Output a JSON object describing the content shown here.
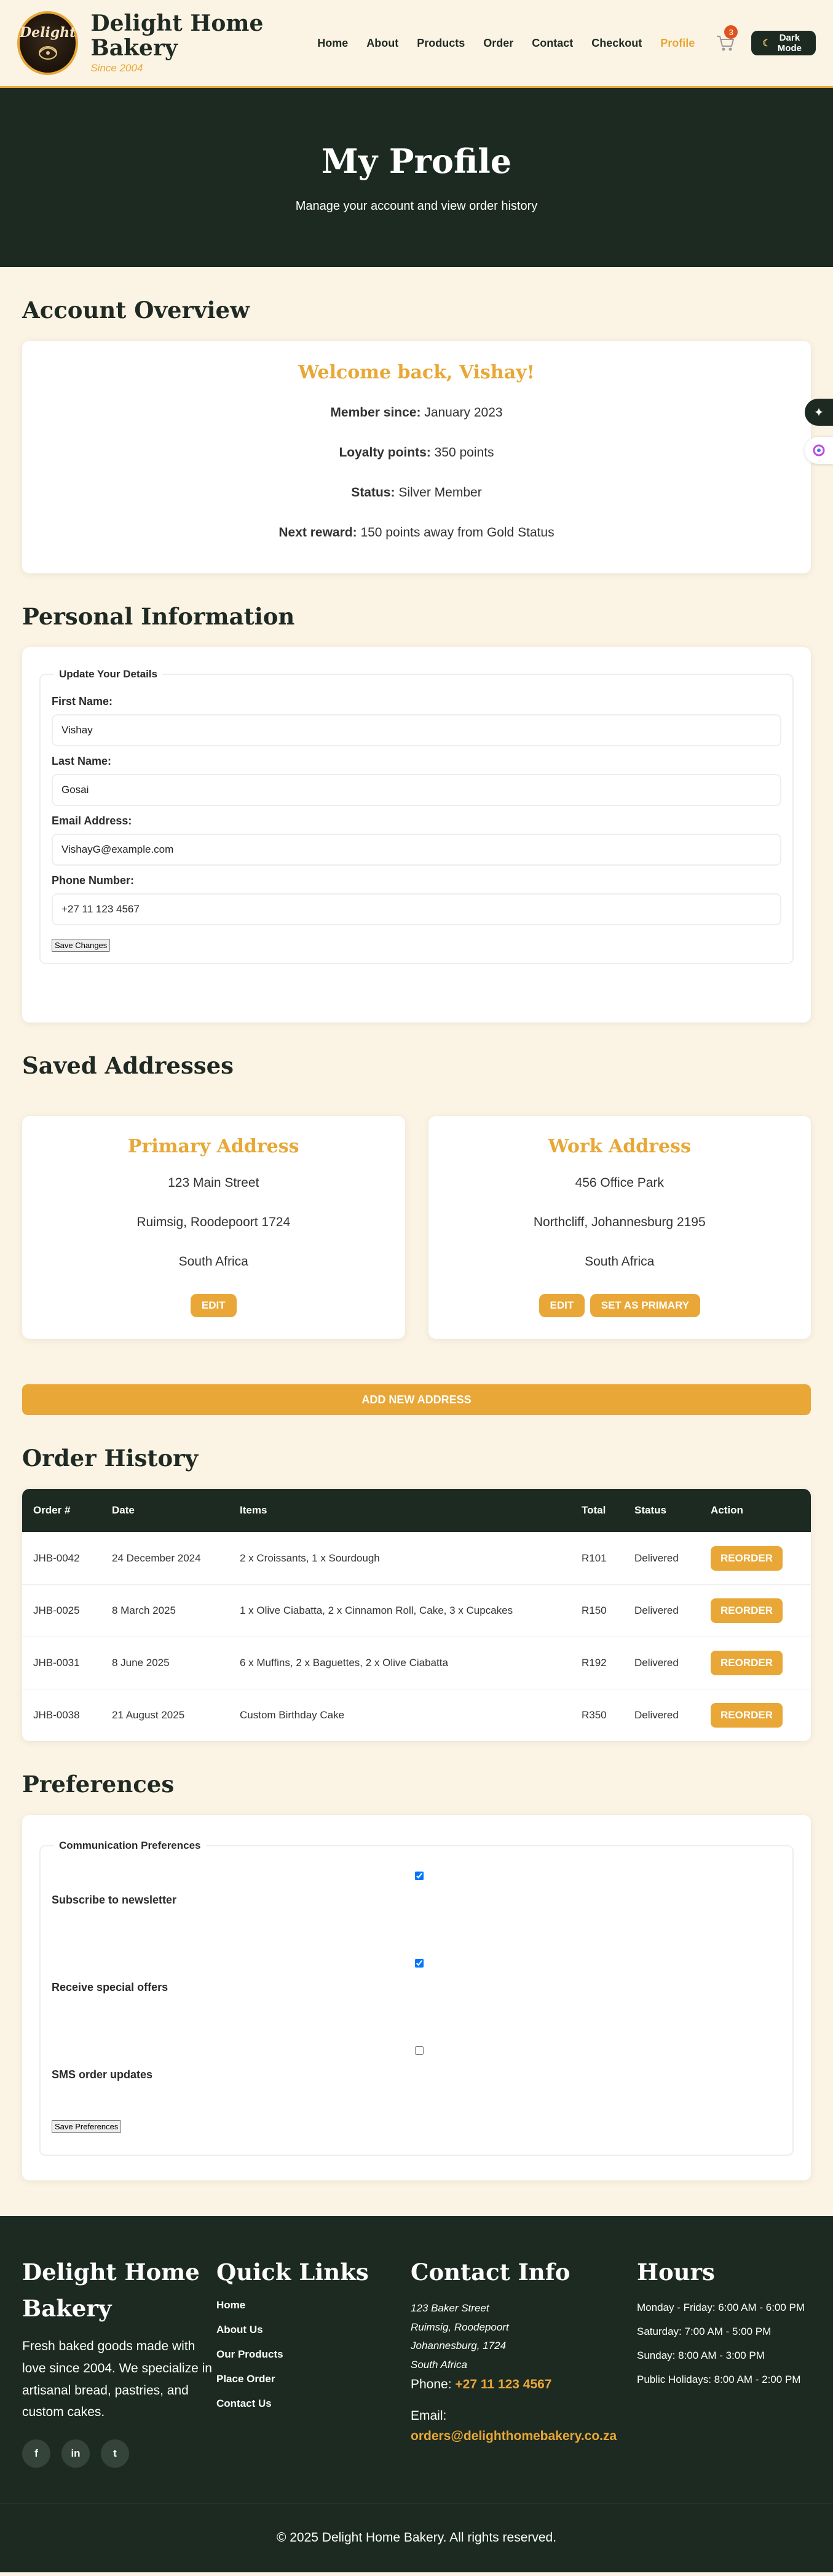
{
  "brand": {
    "logo_text": "Delight",
    "name": "Delight Home Bakery",
    "since": "Since 2004"
  },
  "nav": [
    {
      "label": "Home"
    },
    {
      "label": "About"
    },
    {
      "label": "Products"
    },
    {
      "label": "Order"
    },
    {
      "label": "Contact"
    },
    {
      "label": "Checkout"
    },
    {
      "label": "Profile"
    }
  ],
  "cart": {
    "count": "3",
    "icon": "cart-icon"
  },
  "dark_mode": {
    "label": "Dark Mode",
    "icon": "moon-icon"
  },
  "hero": {
    "title": "My Profile",
    "subtitle": "Manage your account and view order history"
  },
  "overview": {
    "section_title": "Account Overview",
    "welcome": "Welcome back, Vishay!",
    "member_label": "Member since:",
    "member_value": "January 2023",
    "points_label": "Loyalty points:",
    "points_value": "350 points",
    "status_label": "Status:",
    "status_value": "Silver Member",
    "reward_label": "Next reward:",
    "reward_value": "150 points away from Gold Status"
  },
  "personal": {
    "section_title": "Personal Information",
    "legend": "Update Your Details",
    "first_name_label": "First Name:",
    "first_name": "Vishay",
    "last_name_label": "Last Name:",
    "last_name": "Gosai",
    "email_label": "Email Address:",
    "email": "VishayG@example.com",
    "phone_label": "Phone Number:",
    "phone": "+27 11 123 4567",
    "save_label": "Save Changes"
  },
  "addresses": {
    "section_title": "Saved Addresses",
    "items": [
      {
        "title": "Primary Address",
        "line1": "123 Main Street",
        "line2": "Ruimsig, Roodepoort 1724",
        "line3": "South Africa",
        "edit": "EDIT"
      },
      {
        "title": "Work Address",
        "line1": "456 Office Park",
        "line2": "Northcliff, Johannesburg 2195",
        "line3": "South Africa",
        "edit": "EDIT",
        "set_primary": "SET AS PRIMARY"
      }
    ],
    "add_label": "ADD NEW ADDRESS"
  },
  "orders": {
    "section_title": "Order History",
    "headers": [
      "Order #",
      "Date",
      "Items",
      "Total",
      "Status",
      "Action"
    ],
    "rows": [
      {
        "id": "JHB-0042",
        "date": "24 December 2024",
        "items": "2 x Croissants, 1 x Sourdough",
        "total": "R101",
        "status": "Delivered",
        "action": "REORDER"
      },
      {
        "id": "JHB-0025",
        "date": "8 March 2025",
        "items": "1 x Olive Ciabatta, 2 x Cinnamon Roll, Cake, 3 x Cupcakes",
        "total": "R150",
        "status": "Delivered",
        "action": "REORDER"
      },
      {
        "id": "JHB-0031",
        "date": "8 June 2025",
        "items": "6 x Muffins, 2 x Baguettes, 2 x Olive Ciabatta",
        "total": "R192",
        "status": "Delivered",
        "action": "REORDER"
      },
      {
        "id": "JHB-0038",
        "date": "21 August 2025",
        "items": "Custom Birthday Cake",
        "total": "R350",
        "status": "Delivered",
        "action": "REORDER"
      }
    ]
  },
  "preferences": {
    "section_title": "Preferences",
    "legend": "Communication Preferences",
    "items": [
      {
        "label": "Subscribe to newsletter",
        "checked": true
      },
      {
        "label": "Receive special offers",
        "checked": true
      },
      {
        "label": "SMS order updates",
        "checked": false
      }
    ],
    "save_label": "Save Preferences"
  },
  "footer": {
    "about_title": "Delight Home Bakery",
    "about_text": "Fresh baked goods made with love since 2004. We specialize in artisanal bread, pastries, and custom cakes.",
    "socials": [
      "f",
      "in",
      "t"
    ],
    "links_title": "Quick Links",
    "links": [
      "Home",
      "About Us",
      "Our Products",
      "Place Order",
      "Contact Us"
    ],
    "contact_title": "Contact Info",
    "address_lines": [
      "123 Baker Street",
      "Ruimsig, Roodepoort",
      "Johannesburg, 1724",
      "South Africa"
    ],
    "phone_label": "Phone:",
    "phone": "+27 11 123 4567",
    "email_label": "Email:",
    "email": "orders@delighthomebakery.co.za",
    "hours_title": "Hours",
    "hours": [
      "Monday - Friday: 6:00 AM - 6:00 PM",
      "Saturday: 7:00 AM - 5:00 PM",
      "Sunday: 8:00 AM - 3:00 PM",
      "Public Holidays: 8:00 AM - 2:00 PM"
    ],
    "copyright": "© 2025 Delight Home Bakery. All rights reserved."
  },
  "colors": {
    "accent": "#e8a736",
    "dark": "#1c2a22",
    "background": "#fbf3e3"
  }
}
